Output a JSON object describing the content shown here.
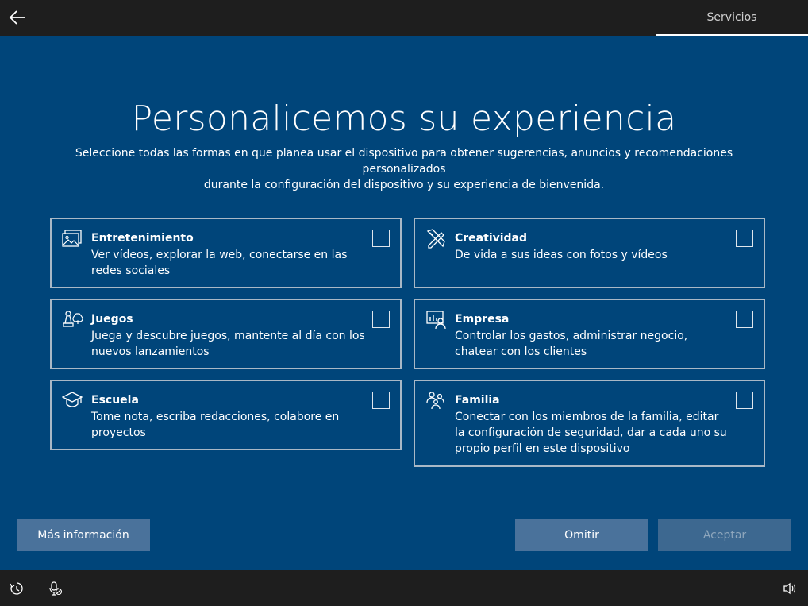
{
  "header": {
    "back_icon": "arrow-left-icon",
    "section_label": "Servicios"
  },
  "page": {
    "title": "Personalicemos su experiencia",
    "subtitle_line1": "Seleccione todas las formas en que planea usar el dispositivo para obtener sugerencias, anuncios y recomendaciones personalizados",
    "subtitle_line2": "durante la configuración del dispositivo y su experiencia de bienvenida."
  },
  "options": [
    {
      "icon": "picture-icon",
      "title": "Entretenimiento",
      "description": "Ver vídeos, explorar la web, conectarse en las redes sociales",
      "checked": false
    },
    {
      "icon": "pen-ruler-icon",
      "title": "Creatividad",
      "description": "De vida a sus ideas con fotos y vídeos",
      "checked": false
    },
    {
      "icon": "game-pieces-icon",
      "title": "Juegos",
      "description": "Juega y descubre juegos, mantente al día con los nuevos lanzamientos",
      "checked": false
    },
    {
      "icon": "business-chart-person-icon",
      "title": "Empresa",
      "description": "Controlar los gastos, administrar negocio, chatear con los clientes",
      "checked": false
    },
    {
      "icon": "graduation-cap-icon",
      "title": "Escuela",
      "description": "Tome nota, escriba redacciones, colabore en proyectos",
      "checked": false
    },
    {
      "icon": "family-icon",
      "title": "Familia",
      "description": "Conectar con los miembros de la familia, editar la configuración de seguridad, dar a cada uno su propio perfil en este dispositivo",
      "checked": false
    }
  ],
  "buttons": {
    "more_info": "Más información",
    "skip": "Omitir",
    "accept": "Aceptar"
  },
  "footer": {
    "accessibility_icon": "ease-of-access-icon",
    "mic_icon": "microphone-muted-icon",
    "volume_icon": "volume-icon"
  },
  "colors": {
    "background": "#00457a",
    "bar": "#1e1e1e",
    "button": "#4a729b",
    "button_disabled": "#3d6890"
  }
}
